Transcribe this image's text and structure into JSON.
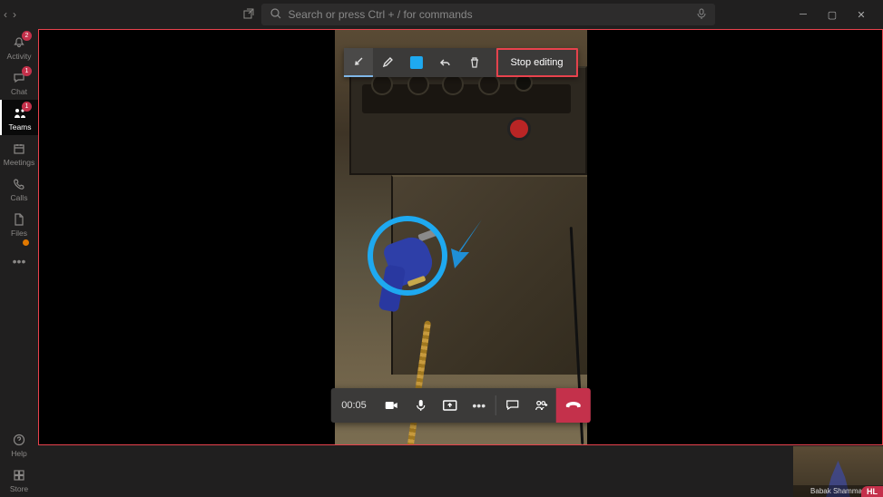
{
  "search": {
    "placeholder": "Search or press Ctrl + / for commands"
  },
  "rail": {
    "items": [
      {
        "label": "Activity",
        "badge": "2"
      },
      {
        "label": "Chat",
        "badge": "1"
      },
      {
        "label": "Teams",
        "badge": "1"
      },
      {
        "label": "Meetings"
      },
      {
        "label": "Calls"
      },
      {
        "label": "Files"
      }
    ],
    "help": "Help",
    "store": "Store"
  },
  "ink_toolbar": {
    "stop_edit_label": "Stop editing"
  },
  "call": {
    "timer": "00:05"
  },
  "pip": {
    "name": "Babak Shammas",
    "badge": "HL"
  }
}
